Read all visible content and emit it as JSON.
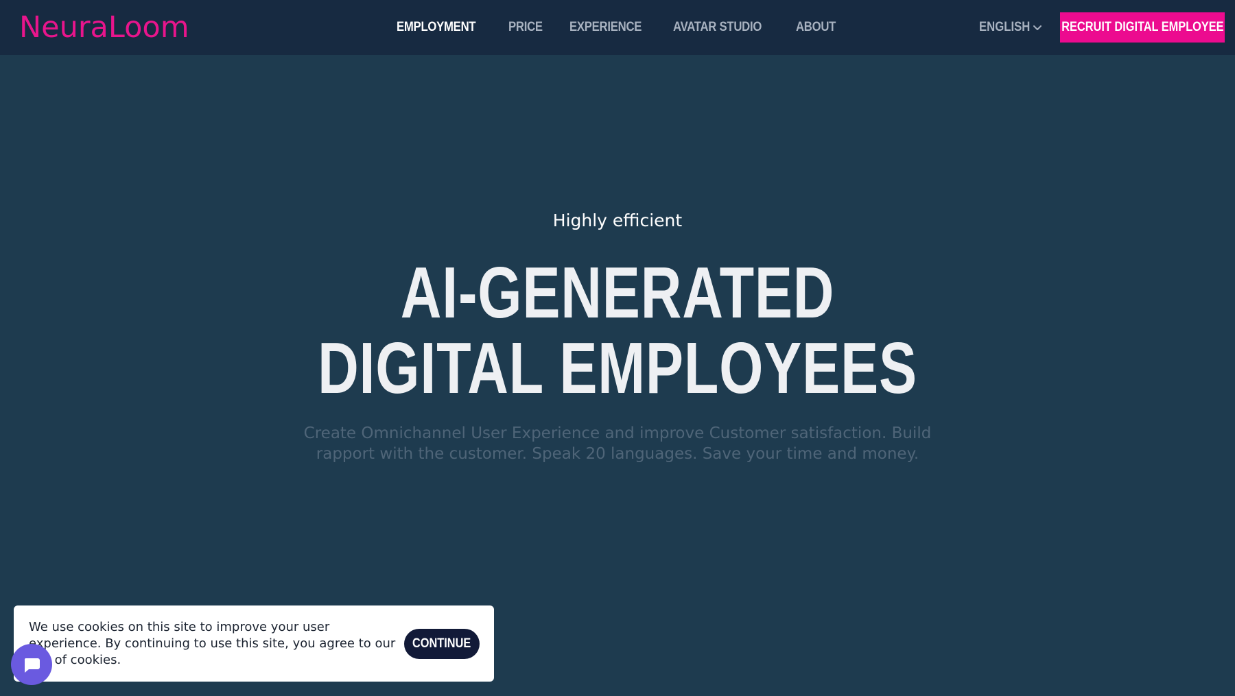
{
  "brand": {
    "logo_text": "NeuraLoom",
    "accent_color": "#ec0b8f"
  },
  "nav": {
    "items": [
      {
        "label": "EMPLOYMENT",
        "active": true
      },
      {
        "label": "PRICE",
        "active": false
      },
      {
        "label": "EXPERIENCE",
        "active": false
      },
      {
        "label": "AVATAR STUDIO",
        "active": false
      },
      {
        "label": "ABOUT",
        "active": false
      }
    ],
    "language": "ENGLISH",
    "language_icon": "chevron-down-icon",
    "cta_label": "RECRUIT DIGITAL EMPLOYEE"
  },
  "hero": {
    "eyebrow": "Highly efficient",
    "title_line1": "AI-GENERATED",
    "title_line2": "DIGITAL EMPLOYEES",
    "subtitle": "Create Omnichannel User Experience and improve Customer satisfaction. Build rapport with the customer. Speak 20 languages. Save your time and money."
  },
  "cookie_banner": {
    "message_part1": "We use cookies on this site to improve your user experience. By continuing to use this site, you agree to our",
    "message_hidden": "use",
    "message_part2": " of cookies.",
    "button_label": "CONTINUE"
  },
  "chat_widget": {
    "icon": "chat-bubble-icon",
    "color": "#6a5ae0"
  },
  "colors": {
    "nav_background": "#172a41",
    "page_background": "#1e3b4f",
    "cookie_button": "#121a38"
  }
}
